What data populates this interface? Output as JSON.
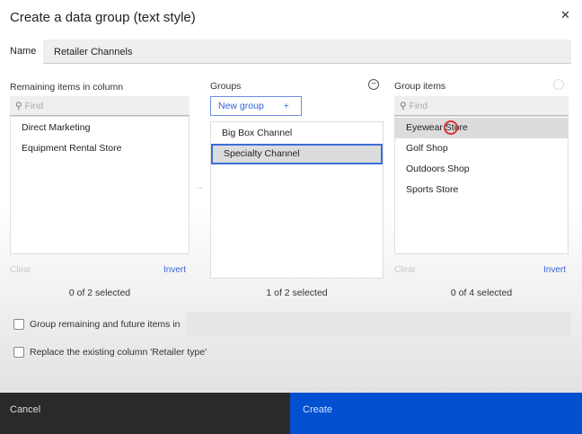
{
  "dialog": {
    "title": "Create a data group (text style)",
    "close_icon": "close-icon"
  },
  "name": {
    "label": "Name",
    "value": "Retailer Channels"
  },
  "remaining": {
    "label": "Remaining items in column",
    "find_placeholder": "Find",
    "items": [
      "Direct Marketing",
      "Equipment Rental Store"
    ],
    "clear": "Clear",
    "invert": "Invert",
    "count": "0 of 2 selected"
  },
  "groups": {
    "label": "Groups",
    "new_group": "New group",
    "add": "+",
    "items": [
      "Big Box Channel",
      "Specialty Channel"
    ],
    "selected_index": 1,
    "count": "1 of 2 selected"
  },
  "group_items": {
    "label": "Group items",
    "find_placeholder": "Find",
    "items": [
      "Eyewear Store",
      "Golf Shop",
      "Outdoors Shop",
      "Sports Store"
    ],
    "clear": "Clear",
    "invert": "Invert",
    "count": "0 of 4 selected"
  },
  "options": {
    "group_remaining": "Group remaining and future items in",
    "replace_column": "Replace the existing column 'Retailer type'"
  },
  "footer": {
    "cancel": "Cancel",
    "create": "Create"
  },
  "colors": {
    "primary": "#0050d0",
    "secondary": "#2a2a2a",
    "link": "#3a64d8"
  }
}
